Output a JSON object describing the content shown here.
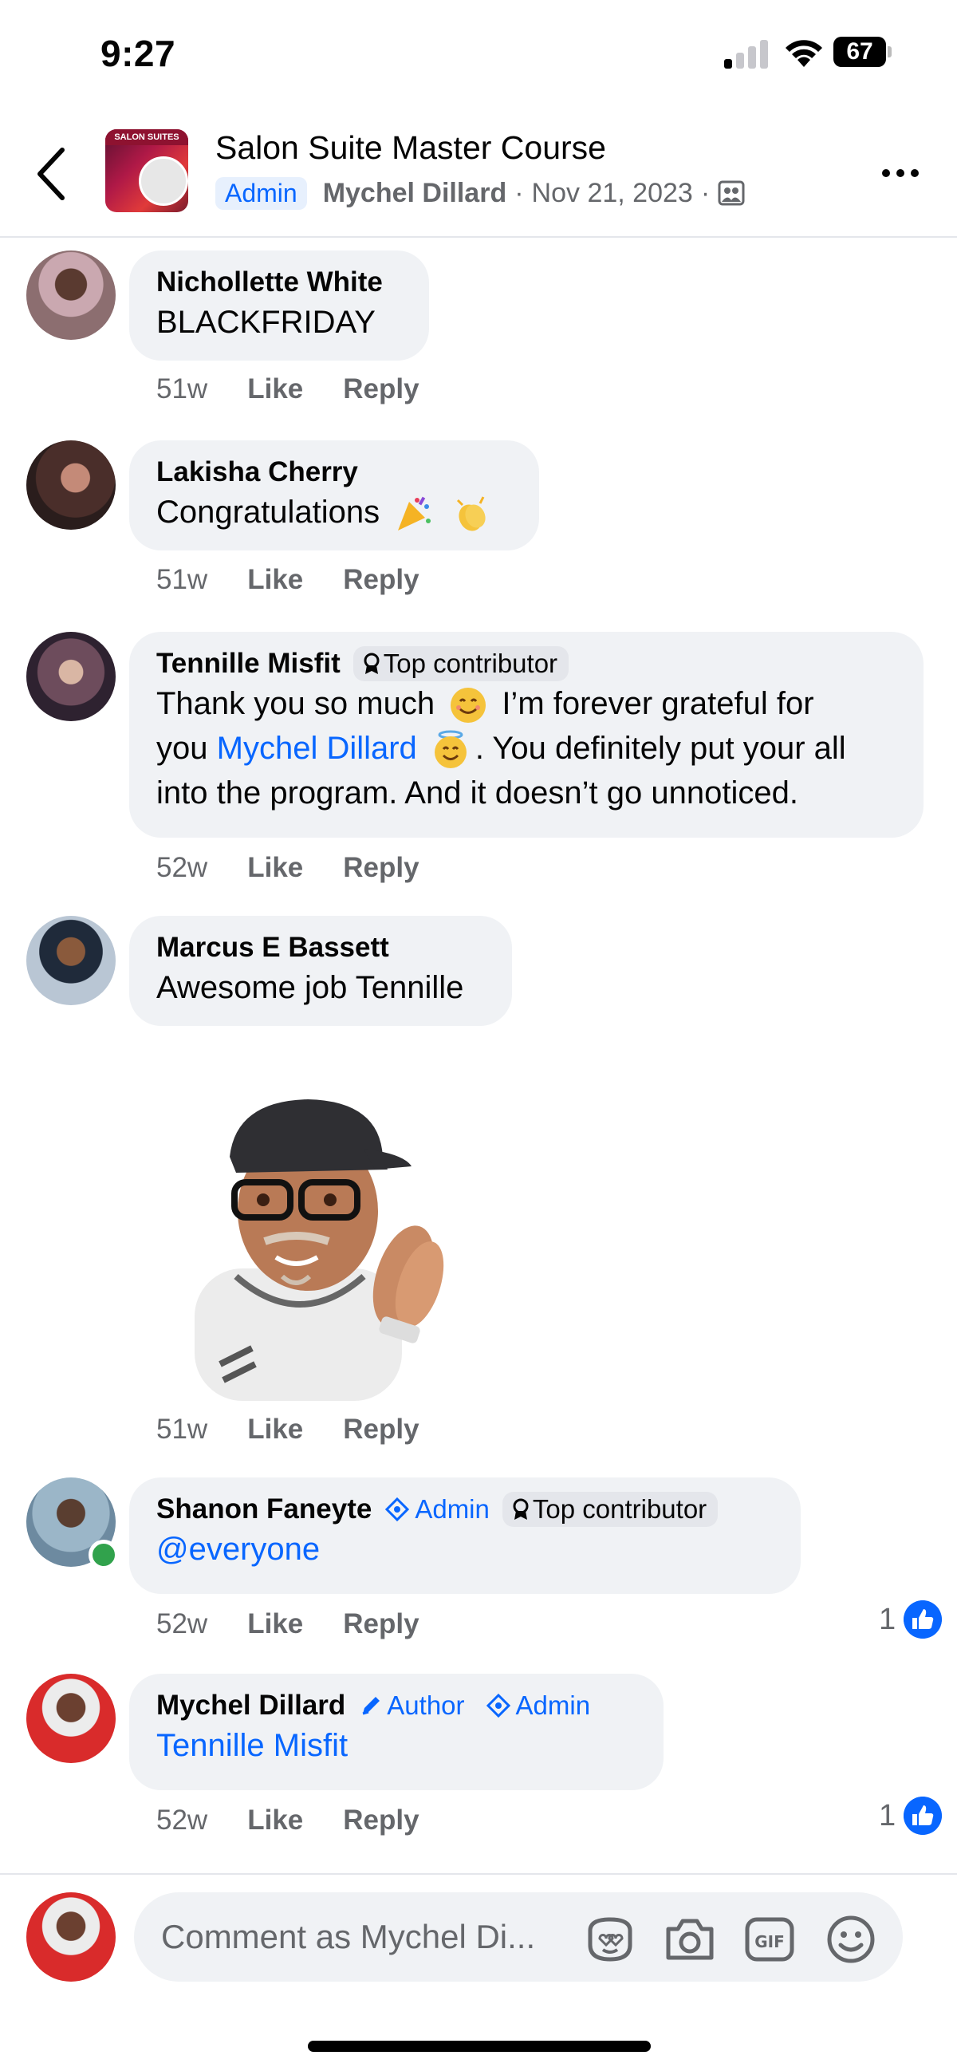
{
  "status_bar": {
    "time": "9:27",
    "battery": "67"
  },
  "header": {
    "group_name": "Salon Suite Master Course",
    "thumb_banner": "SALON SUITES",
    "admin_label": "Admin",
    "post_author": "Mychel Dillard",
    "date": "Nov 21, 2023",
    "separator": "·"
  },
  "comments": [
    {
      "name": "Nichollette White",
      "text": "BLACKFRIDAY",
      "time": "51w",
      "like": "Like",
      "reply": "Reply"
    },
    {
      "name": "Lakisha Cherry",
      "text": "Congratulations",
      "emojis": [
        "party-popper",
        "clapping-hands"
      ],
      "time": "51w",
      "like": "Like",
      "reply": "Reply"
    },
    {
      "name": "Tennille Misfit",
      "badge": "Top contributor",
      "text_line1": "Thank you so much",
      "text_line1b": "I’m forever grateful for",
      "text_line2_pre": "you",
      "mention": "Mychel Dillard",
      "text_line2_post": ". You definitely put your all",
      "text_line3": "into the program. And it doesn’t go unnoticed.",
      "emojis": [
        "smiling-face",
        "smiling-face-with-halo"
      ],
      "time": "52w",
      "like": "Like",
      "reply": "Reply"
    },
    {
      "name": "Marcus E Bassett",
      "text": "Awesome job Tennille",
      "sticker": "avatar-clapping-sticker",
      "time": "51w",
      "like": "Like",
      "reply": "Reply"
    },
    {
      "name": "Shanon Faneyte",
      "badge_admin": "Admin",
      "badge_top": "Top contributor",
      "mention": "@everyone",
      "time": "52w",
      "like": "Like",
      "reply": "Reply",
      "reactions": "1",
      "online": true
    },
    {
      "name": "Mychel Dillard",
      "badge_author": "Author",
      "badge_admin": "Admin",
      "mention": "Tennille Misfit",
      "time": "52w",
      "like": "Like",
      "reply": "Reply",
      "reactions": "1"
    }
  ],
  "composer": {
    "placeholder": "Comment as Mychel Di...",
    "icons": [
      "avatar-sticker-icon",
      "camera-icon",
      "gif-icon",
      "emoji-icon"
    ]
  },
  "colors": {
    "accent": "#0866ff",
    "bubble": "#f0f2f5",
    "muted": "#65676b",
    "online": "#31a24c"
  }
}
